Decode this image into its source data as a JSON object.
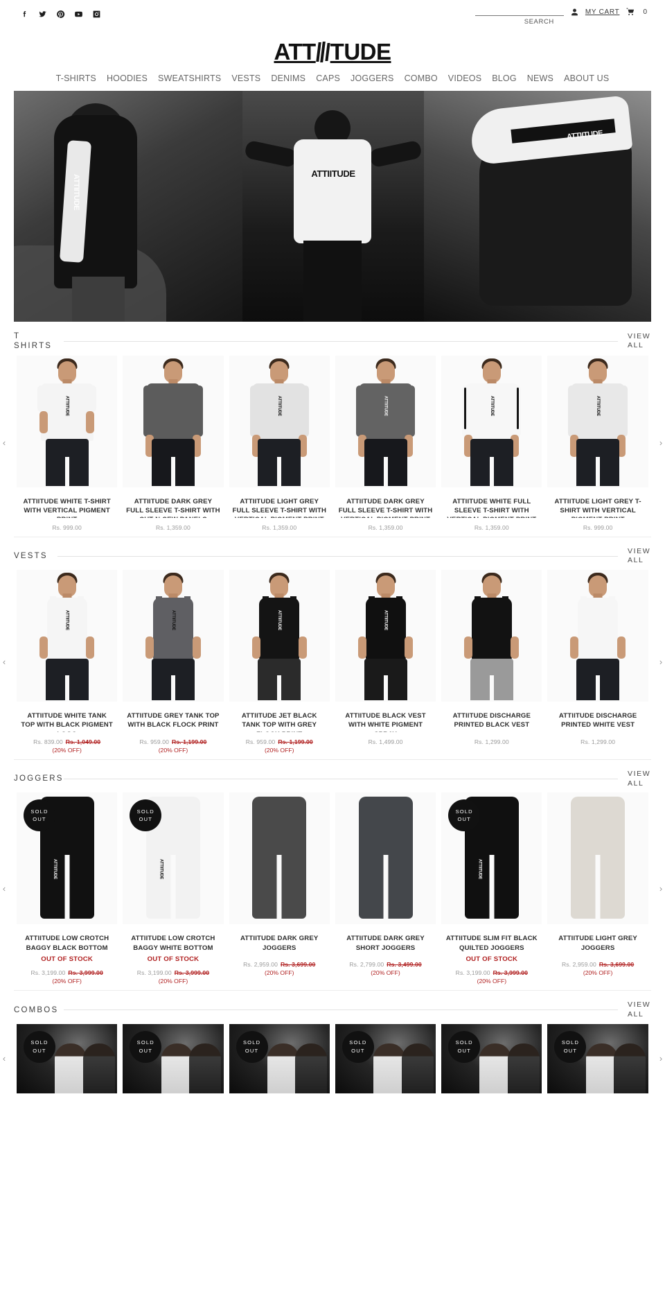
{
  "topbar": {
    "social": [
      {
        "name": "facebook-icon",
        "label": "Facebook"
      },
      {
        "name": "twitter-icon",
        "label": "Twitter"
      },
      {
        "name": "pinterest-icon",
        "label": "Pinterest"
      },
      {
        "name": "youtube-icon",
        "label": "YouTube"
      },
      {
        "name": "instagram-icon",
        "label": "Instagram"
      }
    ],
    "search_value": "",
    "search_placeholder": "",
    "search_label": "SEARCH",
    "my_cart_label": "MY CART",
    "cart_count": "0"
  },
  "brand": {
    "name_left": "ATT",
    "name_right": "TUDE",
    "full": "ATTIITUDE"
  },
  "nav": [
    {
      "label": "T-SHIRTS"
    },
    {
      "label": "HOODIES"
    },
    {
      "label": "SWEATSHIRTS"
    },
    {
      "label": "VESTS"
    },
    {
      "label": "DENIMS"
    },
    {
      "label": "CAPS"
    },
    {
      "label": "JOGGERS"
    },
    {
      "label": "COMBO"
    },
    {
      "label": "VIDEOS"
    },
    {
      "label": "BLOG"
    },
    {
      "label": "NEWS"
    },
    {
      "label": "ABOUT US"
    }
  ],
  "hero": {
    "alt": "Attiitude streetwear banner collage",
    "center_text": "ATTIITUDE",
    "left_text": "ATTIITUDE",
    "right_text": "ATTIITUDE"
  },
  "common": {
    "view_all": "VIEW ALL",
    "prev_arrow": "‹",
    "next_arrow": "›",
    "sold_out_badge_line1": "SOLD",
    "sold_out_badge_line2": "OUT",
    "out_of_stock": "OUT OF STOCK"
  },
  "sections": [
    {
      "id": "t-shirts",
      "title": "T SHIRTS",
      "view_all": "VIEW ALL",
      "products": [
        {
          "title": "ATTIITUDE WHITE T-SHIRT WITH VERTICAL PIGMENT PRINT",
          "price": "Rs. 999.00",
          "old_price": "",
          "off": "",
          "sold_out": false,
          "kind": "tshirt",
          "shirt": "#f4f4f4",
          "sleeve": "#f4f4f4",
          "pants": "#1d1f24",
          "logo": "ATTIITUDE",
          "logo_light": false,
          "stripes": ""
        },
        {
          "title": "ATTIITUDE DARK GREY FULL SLEEVE T-SHIRT WITH CUT-N-SEW PANELS",
          "price": "Rs. 1,359.00",
          "old_price": "",
          "off": "",
          "sold_out": false,
          "kind": "longsleeve",
          "shirt": "#5c5c5c",
          "sleeve": "#5c5c5c",
          "pants": "#17181c",
          "logo": "",
          "logo_light": true,
          "stripes": ""
        },
        {
          "title": "ATTIITUDE LIGHT GREY FULL SLEEVE T-SHIRT WITH VERTICAL PIGMENT PRINT",
          "price": "Rs. 1,359.00",
          "old_price": "",
          "off": "",
          "sold_out": false,
          "kind": "longsleeve",
          "shirt": "#e2e2e2",
          "sleeve": "#e2e2e2",
          "pants": "#1d1f24",
          "logo": "ATTIITUDE",
          "logo_light": false,
          "stripes": ""
        },
        {
          "title": "ATTIITUDE DARK GREY FULL SLEEVE T-SHIRT WITH VERTICAL PIGMENT PRINT",
          "price": "Rs. 1,359.00",
          "old_price": "",
          "off": "",
          "sold_out": false,
          "kind": "longsleeve",
          "shirt": "#636363",
          "sleeve": "#636363",
          "pants": "#17181c",
          "logo": "ATTIITUDE",
          "logo_light": true,
          "stripes": ""
        },
        {
          "title": "ATTIITUDE WHITE FULL SLEEVE T-SHIRT WITH VERTICAL PIGMENT PRINT",
          "price": "Rs. 1,359.00",
          "old_price": "",
          "off": "",
          "sold_out": false,
          "kind": "longsleeve",
          "shirt": "#f7f7f7",
          "sleeve": "#f7f7f7",
          "pants": "#1d1f24",
          "logo": "ATTIITUDE",
          "logo_light": false,
          "stripes": "black"
        },
        {
          "title": "ATTIITUDE LIGHT GREY T-SHIRT WITH VERTICAL PIGMENT PRINT",
          "price": "Rs. 999.00",
          "old_price": "",
          "off": "",
          "sold_out": false,
          "kind": "longsleeve",
          "shirt": "#e8e8e8",
          "sleeve": "#e8e8e8",
          "pants": "#1d1f24",
          "logo": "ATTIITUDE",
          "logo_light": false,
          "stripes": ""
        }
      ]
    },
    {
      "id": "vests",
      "title": "VESTS",
      "view_all": "VIEW ALL",
      "products": [
        {
          "title": "ATTIITUDE WHITE TANK TOP WITH BLACK PIGMENT LOGO",
          "price": "Rs. 839.00",
          "old_price": "Rs. 1,049.00",
          "off": "(20% OFF)",
          "sold_out": false,
          "kind": "vest",
          "shirt": "#f5f5f5",
          "pants": "#1d1f24",
          "logo": "ATTIITUDE",
          "logo_light": false
        },
        {
          "title": "ATTIITUDE GREY TANK TOP WITH BLACK FLOCK PRINT",
          "price": "Rs. 959.00",
          "old_price": "Rs. 1,199.00",
          "off": "(20% OFF)",
          "sold_out": false,
          "kind": "vest",
          "shirt": "#5f5f63",
          "pants": "#1d1f24",
          "logo": "ATTIITUDE",
          "logo_light": false
        },
        {
          "title": "ATTIITUDE JET BLACK TANK TOP WITH GREY FLOCK PRINT",
          "price": "Rs. 959.00",
          "old_price": "Rs. 1,199.00",
          "off": "(20% OFF)",
          "sold_out": false,
          "kind": "vest",
          "shirt": "#141414",
          "pants": "#2b2b2b",
          "logo": "ATTIITUDE",
          "logo_light": true
        },
        {
          "title": "ATTIITUDE BLACK VEST WITH WHITE PIGMENT SPRAY",
          "price": "Rs. 1,499.00",
          "old_price": "",
          "off": "",
          "sold_out": false,
          "kind": "vest",
          "shirt": "#101010",
          "pants": "#1a1a1a",
          "logo": "ATTIITUDE",
          "logo_light": true
        },
        {
          "title": "ATTIITUDE DISCHARGE PRINTED BLACK VEST",
          "price": "Rs. 1,299.00",
          "old_price": "",
          "off": "",
          "sold_out": false,
          "kind": "vest",
          "shirt": "#121212",
          "pants": "#9a9a9a",
          "logo": "",
          "logo_light": true
        },
        {
          "title": "ATTIITUDE DISCHARGE PRINTED WHITE VEST",
          "price": "Rs. 1,299.00",
          "old_price": "",
          "off": "",
          "sold_out": false,
          "kind": "vest",
          "shirt": "#f6f6f6",
          "pants": "#1d1f24",
          "logo": "",
          "logo_light": false
        }
      ]
    },
    {
      "id": "joggers",
      "title": "JOGGERS",
      "view_all": "VIEW ALL",
      "products": [
        {
          "title": "ATTIITUDE LOW CROTCH BAGGY BLACK BOTTOM",
          "price": "Rs. 3,199.00",
          "old_price": "Rs. 3,999.00",
          "off": "(20% OFF)",
          "sold_out": true,
          "kind": "jogger",
          "pants": "#111111",
          "logo": "ATTIITUDE",
          "logo_light": true
        },
        {
          "title": "ATTIITUDE LOW CROTCH BAGGY WHITE BOTTOM",
          "price": "Rs. 3,199.00",
          "old_price": "Rs. 3,999.00",
          "off": "(20% OFF)",
          "sold_out": true,
          "kind": "jogger",
          "pants": "#f2f2f2",
          "logo": "ATTIITUDE",
          "logo_light": false
        },
        {
          "title": "ATTIITUDE DARK GREY JOGGERS",
          "price": "Rs. 2,959.00",
          "old_price": "Rs. 3,699.00",
          "off": "(20% OFF)",
          "sold_out": false,
          "kind": "jogger",
          "pants": "#4a4a4a",
          "logo": "",
          "logo_light": true
        },
        {
          "title": "ATTIITUDE DARK GREY SHORT JOGGERS",
          "price": "Rs. 2,799.00",
          "old_price": "Rs. 3,499.00",
          "off": "(20% OFF)",
          "sold_out": false,
          "kind": "jogger",
          "pants": "#44474b",
          "logo": "",
          "logo_light": true
        },
        {
          "title": "ATTIITUDE SLIM FIT BLACK QUILTED JOGGERS",
          "price": "Rs. 3,199.00",
          "old_price": "Rs. 3,999.00",
          "off": "(20% OFF)",
          "sold_out": true,
          "kind": "jogger",
          "pants": "#101010",
          "logo": "ATTIITUDE",
          "logo_light": true
        },
        {
          "title": "ATTIITUDE LIGHT GREY JOGGERS",
          "price": "Rs. 2,959.00",
          "old_price": "Rs. 3,699.00",
          "off": "(20% OFF)",
          "sold_out": false,
          "kind": "jogger",
          "pants": "#ddd9d2",
          "logo": "",
          "logo_light": false
        }
      ]
    },
    {
      "id": "combos",
      "title": "COMBOS",
      "view_all": "VIEW ALL",
      "products": [
        {
          "title": "",
          "price": "",
          "old_price": "",
          "off": "",
          "sold_out": true,
          "kind": "combo"
        },
        {
          "title": "",
          "price": "",
          "old_price": "",
          "off": "",
          "sold_out": true,
          "kind": "combo"
        },
        {
          "title": "",
          "price": "",
          "old_price": "",
          "off": "",
          "sold_out": true,
          "kind": "combo"
        },
        {
          "title": "",
          "price": "",
          "old_price": "",
          "off": "",
          "sold_out": true,
          "kind": "combo"
        },
        {
          "title": "",
          "price": "",
          "old_price": "",
          "off": "",
          "sold_out": true,
          "kind": "combo"
        },
        {
          "title": "",
          "price": "",
          "old_price": "",
          "off": "",
          "sold_out": true,
          "kind": "combo"
        }
      ]
    }
  ]
}
